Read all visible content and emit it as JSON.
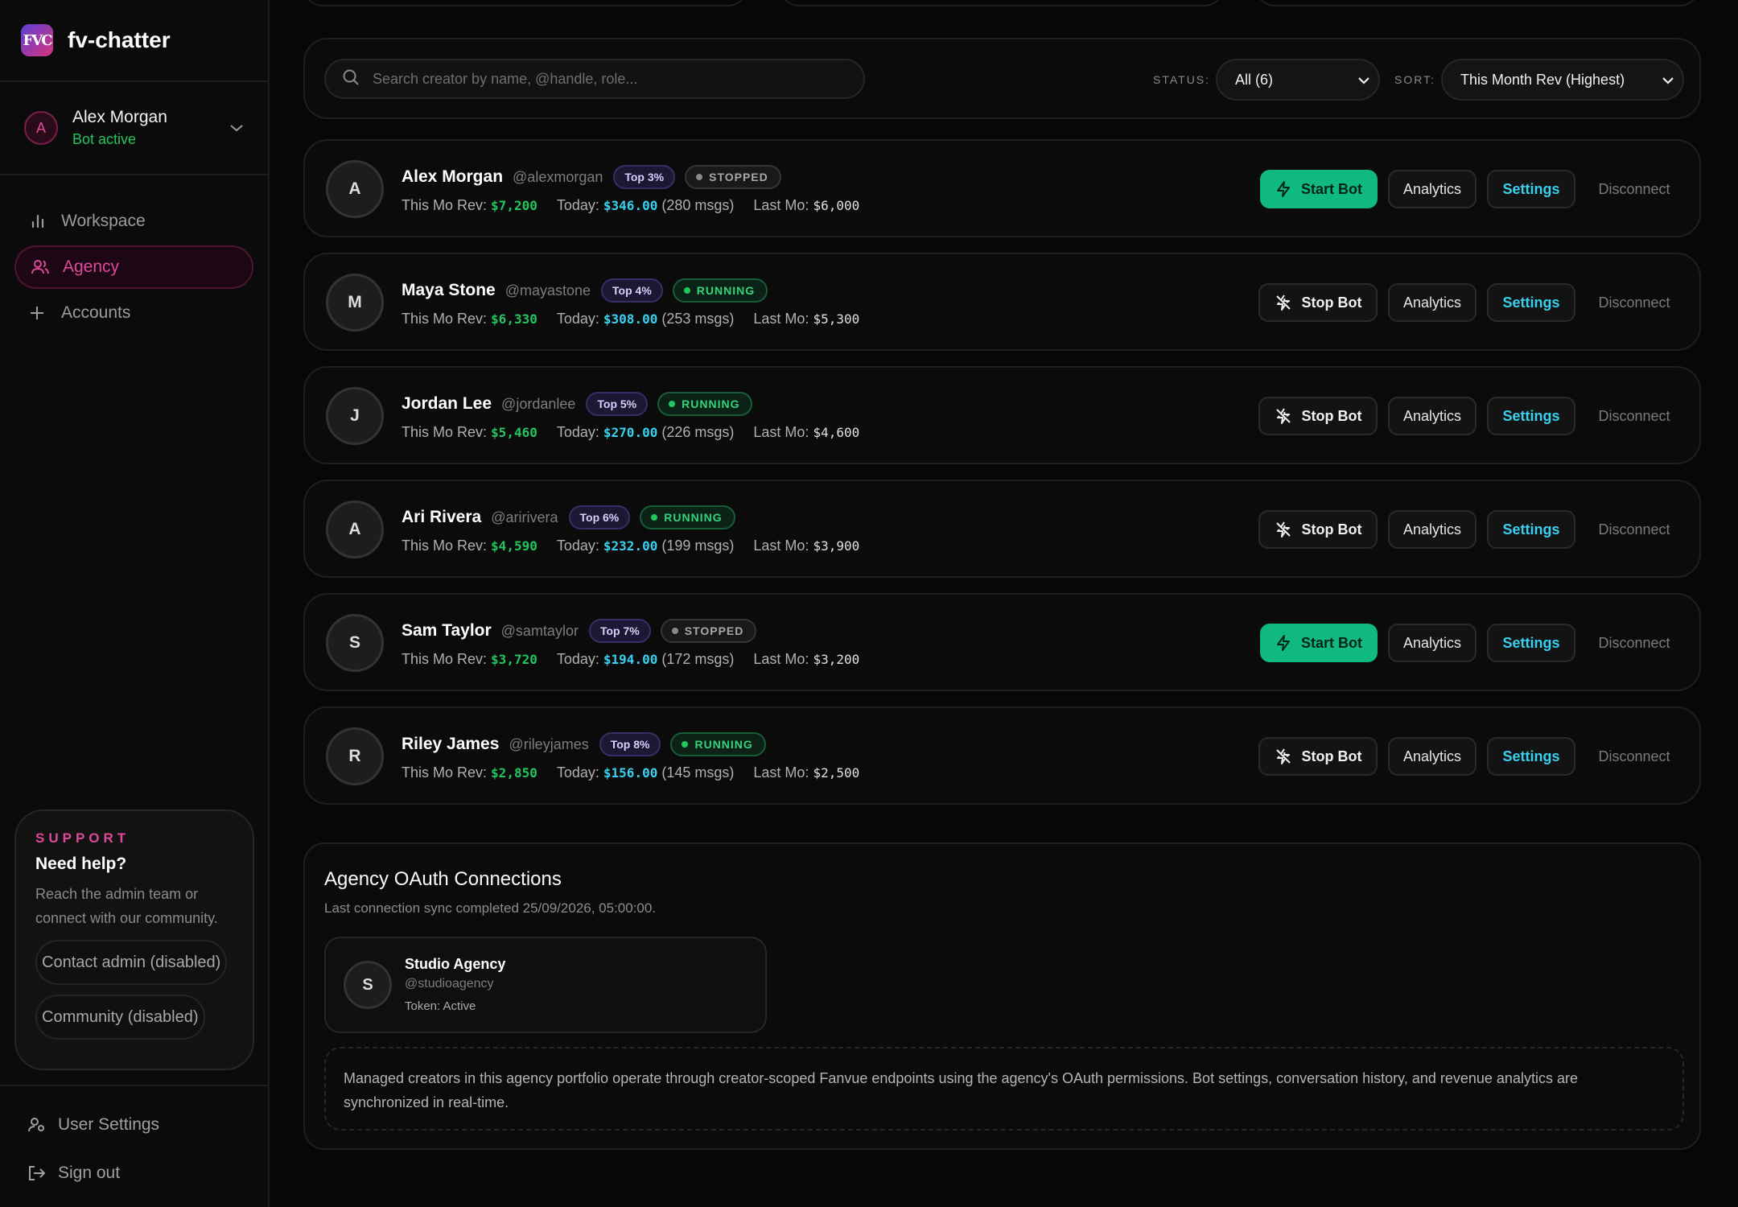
{
  "app": {
    "name": "fv-chatter",
    "logo_text": "FVC"
  },
  "user": {
    "initial": "A",
    "name": "Alex Morgan",
    "status": "Bot active"
  },
  "nav": [
    {
      "label": "Workspace",
      "icon": "bar-chart-icon"
    },
    {
      "label": "Agency",
      "icon": "users-icon",
      "active": true
    },
    {
      "label": "Accounts",
      "icon": "plus-icon"
    }
  ],
  "support": {
    "kicker": "SUPPORT",
    "title": "Need help?",
    "desc": "Reach the admin team or connect with our community.",
    "contact_label": "Contact admin (disabled)",
    "community_label": "Community (disabled)"
  },
  "footer": {
    "settings_label": "User Settings",
    "signout_label": "Sign out"
  },
  "filters": {
    "search_placeholder": "Search creator by name, @handle, role...",
    "status_label": "STATUS:",
    "status_value": "All (6)",
    "sort_label": "SORT:",
    "sort_value": "This Month Rev (Highest)"
  },
  "labels": {
    "this_mo": "This Mo Rev:",
    "today": "Today:",
    "last_mo": "Last Mo:",
    "start_bot": "Start Bot",
    "stop_bot": "Stop Bot",
    "analytics": "Analytics",
    "settings": "Settings",
    "disconnect": "Disconnect"
  },
  "creators": [
    {
      "initial": "A",
      "name": "Alex Morgan",
      "handle": "@alexmorgan",
      "rank": "Top 3%",
      "status": "STOPPED",
      "this_mo": "$7,200",
      "today": "$346.00",
      "msgs": "(280 msgs)",
      "last_mo": "$6,000"
    },
    {
      "initial": "M",
      "name": "Maya Stone",
      "handle": "@mayastone",
      "rank": "Top 4%",
      "status": "RUNNING",
      "this_mo": "$6,330",
      "today": "$308.00",
      "msgs": "(253 msgs)",
      "last_mo": "$5,300"
    },
    {
      "initial": "J",
      "name": "Jordan Lee",
      "handle": "@jordanlee",
      "rank": "Top 5%",
      "status": "RUNNING",
      "this_mo": "$5,460",
      "today": "$270.00",
      "msgs": "(226 msgs)",
      "last_mo": "$4,600"
    },
    {
      "initial": "A",
      "name": "Ari Rivera",
      "handle": "@aririvera",
      "rank": "Top 6%",
      "status": "RUNNING",
      "this_mo": "$4,590",
      "today": "$232.00",
      "msgs": "(199 msgs)",
      "last_mo": "$3,900"
    },
    {
      "initial": "S",
      "name": "Sam Taylor",
      "handle": "@samtaylor",
      "rank": "Top 7%",
      "status": "STOPPED",
      "this_mo": "$3,720",
      "today": "$194.00",
      "msgs": "(172 msgs)",
      "last_mo": "$3,200"
    },
    {
      "initial": "R",
      "name": "Riley James",
      "handle": "@rileyjames",
      "rank": "Top 8%",
      "status": "RUNNING",
      "this_mo": "$2,850",
      "today": "$156.00",
      "msgs": "(145 msgs)",
      "last_mo": "$2,500"
    }
  ],
  "oauth": {
    "title": "Agency OAuth Connections",
    "subtitle": "Last connection sync completed 25/09/2026, 05:00:00.",
    "agency": {
      "initial": "S",
      "name": "Studio Agency",
      "handle": "@studioagency",
      "token": "Token: Active"
    },
    "note": "Managed creators in this agency portfolio operate through creator-scoped Fanvue endpoints using the agency's OAuth permissions. Bot settings, conversation history, and revenue analytics are synchronized in real-time."
  },
  "colors": {
    "accent_pink": "#e0489a",
    "running": "#22c55e",
    "start_button": "#10b981",
    "settings_text": "#38d0ee"
  }
}
